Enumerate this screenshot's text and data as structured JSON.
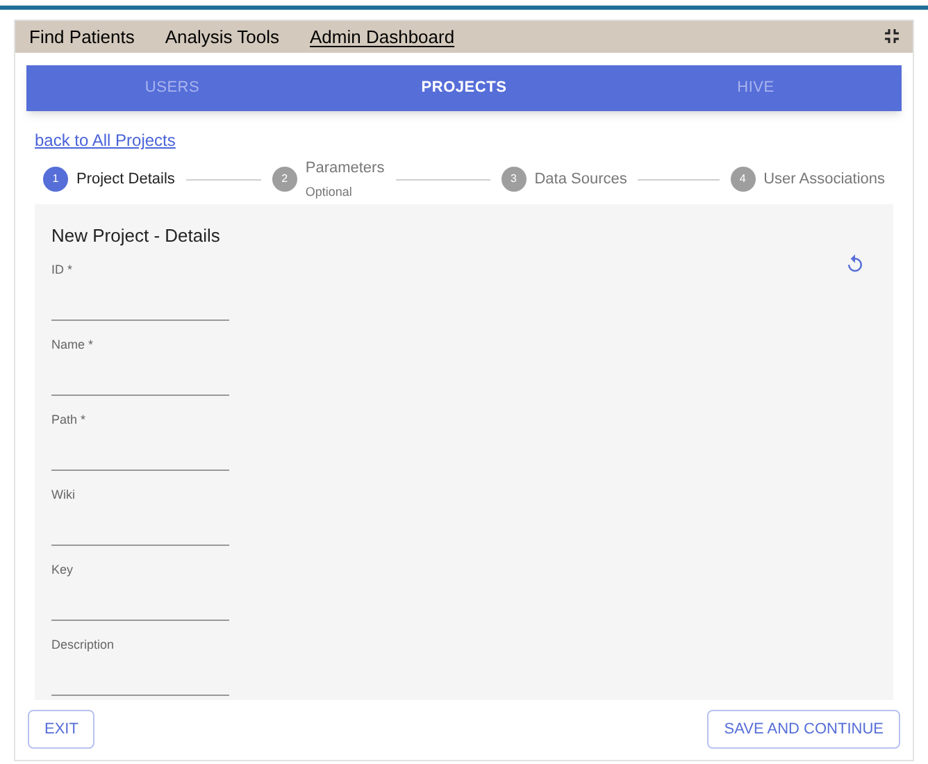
{
  "menu": [
    {
      "label": "Find Patients",
      "selected": false
    },
    {
      "label": "Analysis Tools",
      "selected": false
    },
    {
      "label": "Admin Dashboard",
      "selected": true
    }
  ],
  "tabs": [
    {
      "label": "USERS",
      "selected": false
    },
    {
      "label": "PROJECTS",
      "selected": true
    },
    {
      "label": "HIVE",
      "selected": false
    }
  ],
  "back_link": "back to All Projects",
  "steps": [
    {
      "number": "1",
      "label": "Project Details",
      "selected": true
    },
    {
      "number": "2",
      "label": "Parameters",
      "sublabel": "Optional",
      "selected": false
    },
    {
      "number": "3",
      "label": "Data Sources",
      "selected": false
    },
    {
      "number": "4",
      "label": "User Associations",
      "selected": false
    }
  ],
  "form": {
    "title": "New Project - Details",
    "fields": [
      {
        "label": "ID *"
      },
      {
        "label": "Name *"
      },
      {
        "label": "Path *"
      },
      {
        "label": "Wiki"
      },
      {
        "label": "Key"
      },
      {
        "label": "Description"
      }
    ]
  },
  "buttons": [
    {
      "label": "EXIT"
    },
    {
      "label": "SAVE AND CONTINUE"
    }
  ]
}
